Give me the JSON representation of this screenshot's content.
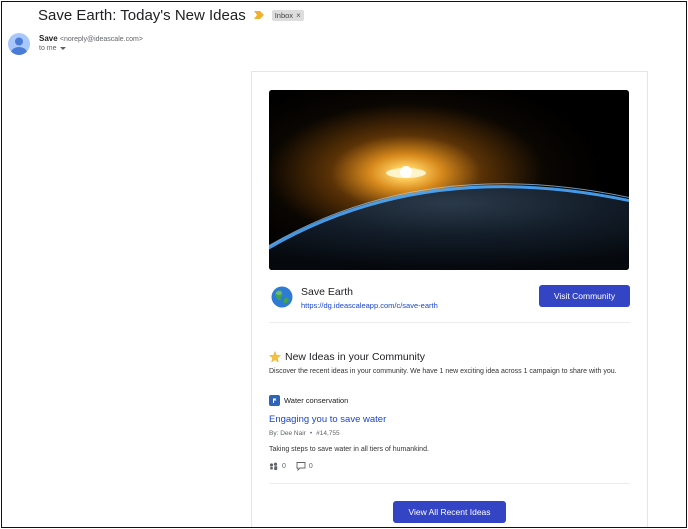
{
  "email": {
    "subject": "Save Earth: Today's New Ideas",
    "label": "Inbox",
    "label_close": "×",
    "sender_name": "Save",
    "sender_email": "<noreply@ideascale.com>",
    "recipient": "to me"
  },
  "community": {
    "name": "Save Earth",
    "url": "https://dg.ideascaleapp.com/c/save-earth",
    "visit_label": "Visit Community"
  },
  "section": {
    "title": "New Ideas in your Community",
    "description": "Discover the recent ideas in your community. We have 1 new exciting idea across 1 campaign to share with you."
  },
  "idea": {
    "campaign": "Water conservation",
    "title": "Engaging you to save water",
    "author": "By: Dee Nair",
    "separator": "•",
    "number": "#14,755",
    "description": "Taking steps to save water in all tiers of humankind.",
    "votes": "0",
    "comments": "0"
  },
  "footer": {
    "view_all_label": "View All Recent Ideas"
  },
  "icons": {
    "importance": "importance-marker-icon",
    "avatar": "person-icon",
    "caret": "caret-down-icon",
    "globe": "globe-icon",
    "star": "star-icon",
    "campaign": "campaign-icon",
    "vote": "vote-icon",
    "comment": "comment-icon"
  },
  "colors": {
    "accent": "#3344c4",
    "link": "#1a46c9",
    "importance": "#f2b12a"
  }
}
